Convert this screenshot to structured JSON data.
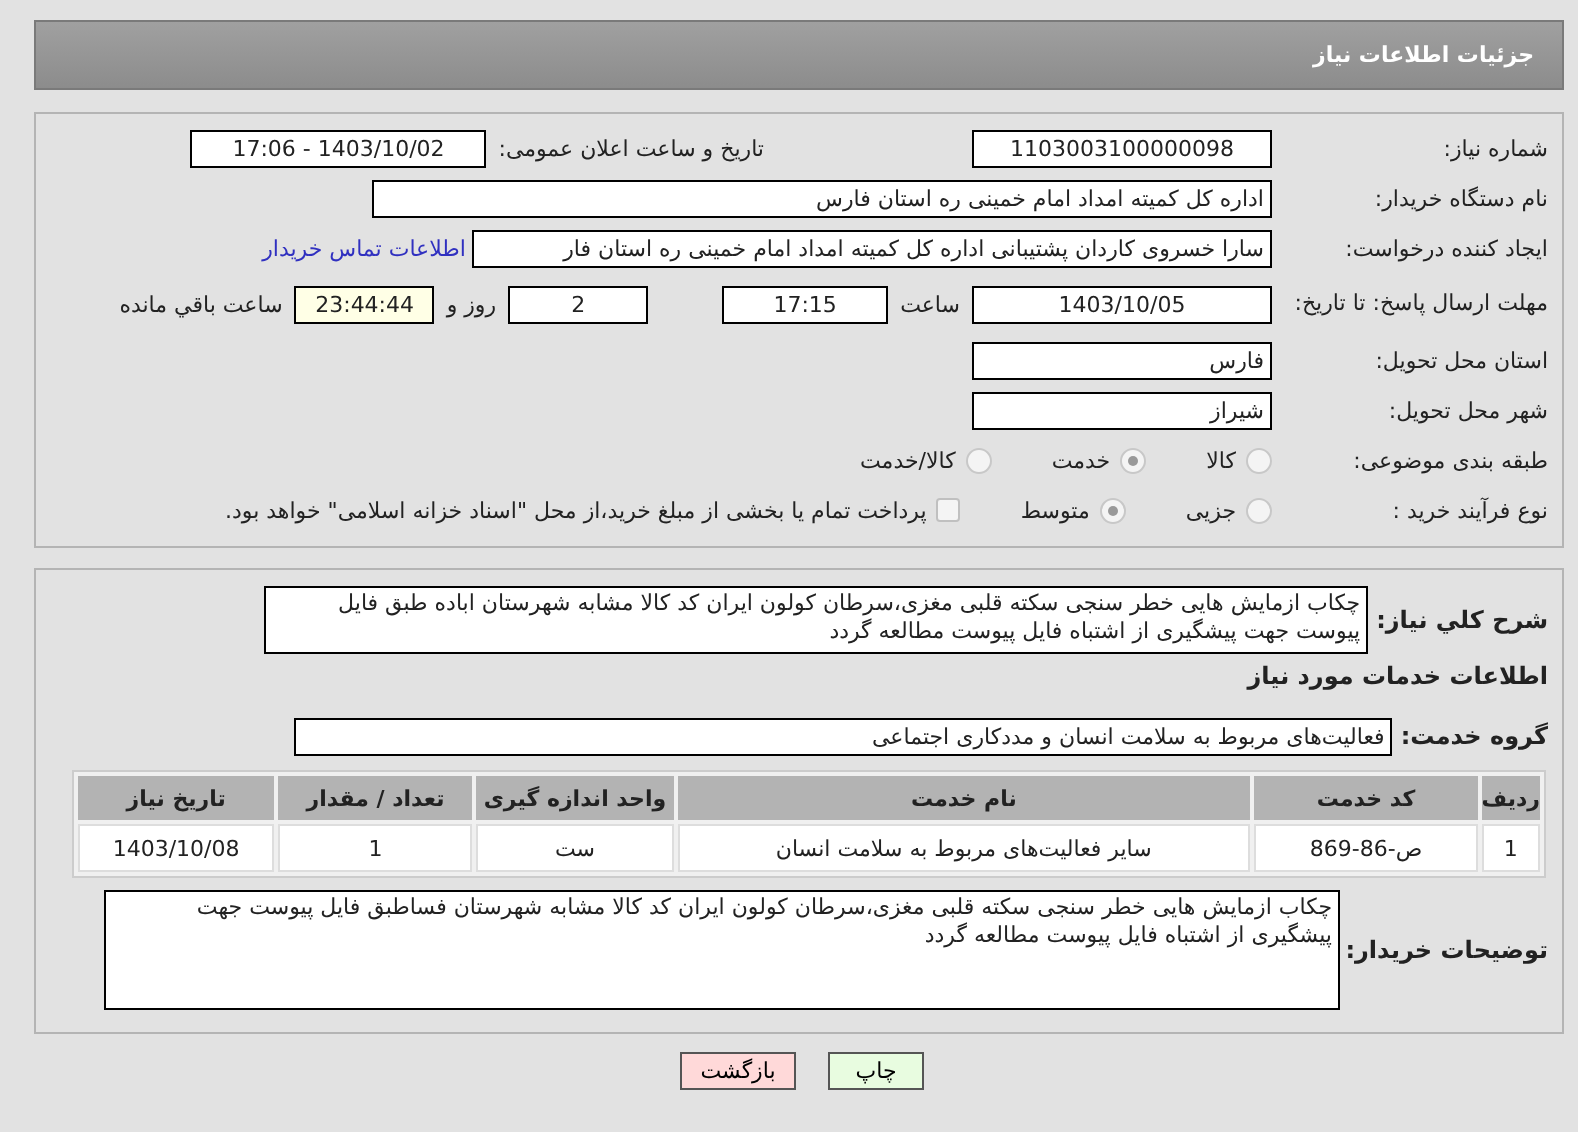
{
  "header": {
    "title": "جزئیات اطلاعات نیاز"
  },
  "need_number": {
    "label": "شماره نیاز:",
    "value": "1103003100000098"
  },
  "announce": {
    "label": "تاریخ و ساعت اعلان عمومی:",
    "value": "1403/10/02 - 17:06"
  },
  "buyer_org": {
    "label": "نام دستگاه خریدار:",
    "value": "اداره کل کمیته امداد امام خمینی  ره  استان فارس"
  },
  "requester": {
    "label": "ایجاد کننده درخواست:",
    "value": "سارا خسروی کاردان پشتیبانی  اداره کل کمیته امداد امام خمینی  ره  استان فار",
    "link": "اطلاعات تماس خریدار"
  },
  "deadline": {
    "label": "مهلت ارسال پاسخ: تا تاریخ:",
    "date": "1403/10/05",
    "time_label": "ساعت",
    "time": "17:15",
    "days": "2",
    "days_label": "روز و",
    "remaining": "23:44:44",
    "remaining_label": "ساعت باقي مانده"
  },
  "province": {
    "label": "استان محل تحویل:",
    "value": "فارس"
  },
  "city": {
    "label": "شهر محل تحویل:",
    "value": "شیراز"
  },
  "category": {
    "label": "طبقه بندی موضوعی:",
    "options": [
      {
        "label": "کالا",
        "selected": false
      },
      {
        "label": "خدمت",
        "selected": true
      },
      {
        "label": "کالا/خدمت",
        "selected": false
      }
    ]
  },
  "purchase_type": {
    "label": "نوع فرآیند خرید :",
    "options": [
      {
        "label": "جزیی",
        "selected": false
      },
      {
        "label": "متوسط",
        "selected": true
      }
    ],
    "treasury": {
      "checked": false,
      "label": "پرداخت تمام یا بخشی از مبلغ خرید،از محل \"اسناد خزانه اسلامی\" خواهد بود."
    }
  },
  "description": {
    "label": "شرح کلي نیاز:",
    "value": "چکاب ازمایش هایی خطر سنجی سکته قلبی مغزی،سرطان کولون  ایران کد کالا مشابه شهرستان اباده طبق فایل پیوست  جهت پیشگیری از اشتباه فایل پیوست مطالعه گردد"
  },
  "services_heading": "اطلاعات خدمات مورد نیاز",
  "service_group": {
    "label": "گروه خدمت:",
    "value": "فعالیت‌های مربوط به سلامت انسان و مددکاری اجتماعی"
  },
  "table": {
    "columns": [
      "ردیف",
      "کد خدمت",
      "نام خدمت",
      "واحد اندازه گیری",
      "تعداد / مقدار",
      "تاریخ نیاز"
    ],
    "rows": [
      [
        "1",
        "ص-86-869",
        "سایر فعالیت‌های مربوط به سلامت انسان",
        "ست",
        "1",
        "1403/10/08"
      ]
    ]
  },
  "buyer_notes": {
    "label": "توضیحات خریدار:",
    "value": "چکاب ازمایش هایی خطر سنجی سکته قلبی مغزی،سرطان کولون  ایران کد کالا مشابه شهرستان فساطبق فایل پیوست  جهت پیشگیری از اشتباه فایل پیوست مطالعه گردد"
  },
  "buttons": [
    {
      "label": "چاپ",
      "kind": "print"
    },
    {
      "label": "بازگشت",
      "kind": "back"
    }
  ]
}
